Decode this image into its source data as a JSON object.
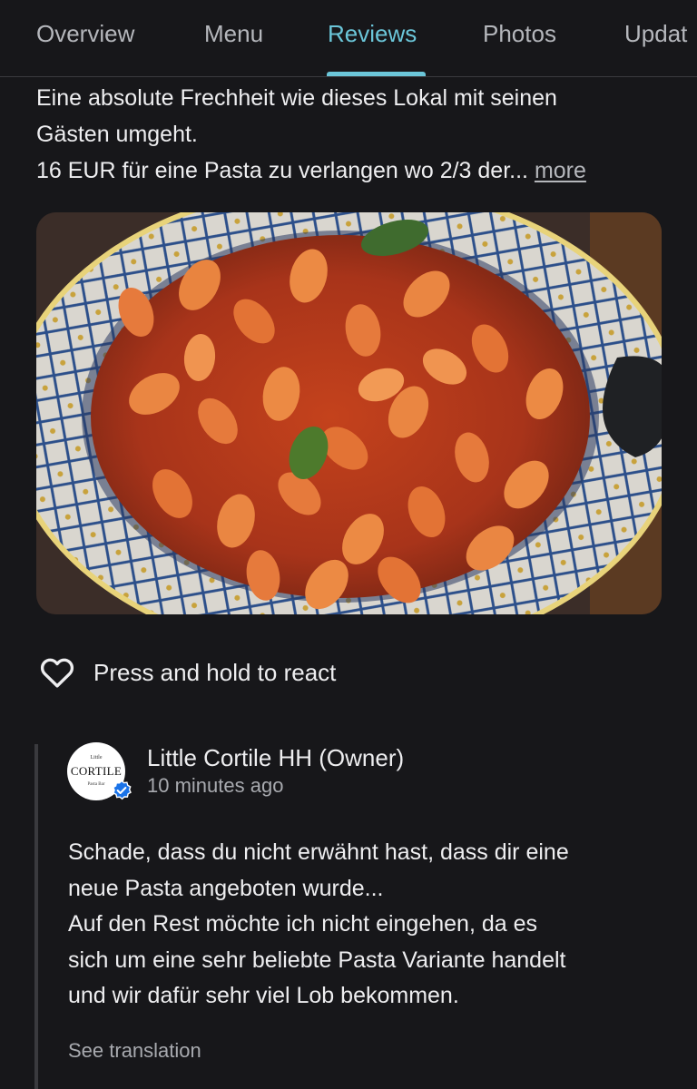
{
  "tabs": [
    {
      "label": "Overview",
      "active": false
    },
    {
      "label": "Menu",
      "active": false
    },
    {
      "label": "Reviews",
      "active": true
    },
    {
      "label": "Photos",
      "active": false
    },
    {
      "label": "Updat",
      "active": false
    }
  ],
  "review": {
    "lines": [
      "Eine absolute Frechheit wie dieses Lokal mit seinen",
      "Gästen umgeht.",
      "16 EUR für eine Pasta zu verlangen wo 2/3 der..."
    ],
    "more_label": "more",
    "photo_icon": "pasta-dish-photo"
  },
  "react": {
    "icon": "heart-icon",
    "label": "Press and hold to react"
  },
  "owner_reply": {
    "name": "Little Cortile HH (Owner)",
    "time": "10 minutes ago",
    "avatar": {
      "top": "Little",
      "name": "CORTILE",
      "sub": "Pasta Bar"
    },
    "verified_icon": "verified-badge-icon",
    "lines": [
      "Schade, dass du nicht erwähnt hast, dass dir eine",
      "neue Pasta angeboten wurde...",
      "Auf den Rest möchte ich nicht eingehen, da es",
      "sich um eine sehr beliebte Pasta Variante handelt",
      "und wir dafür sehr viel Lob bekommen."
    ],
    "see_translation_label": "See translation"
  },
  "colors": {
    "background": "#17171a",
    "accent": "#6bc6d9",
    "text_primary": "#eeeef0",
    "text_secondary": "#a8aaaf",
    "verified": "#1a73e8"
  }
}
